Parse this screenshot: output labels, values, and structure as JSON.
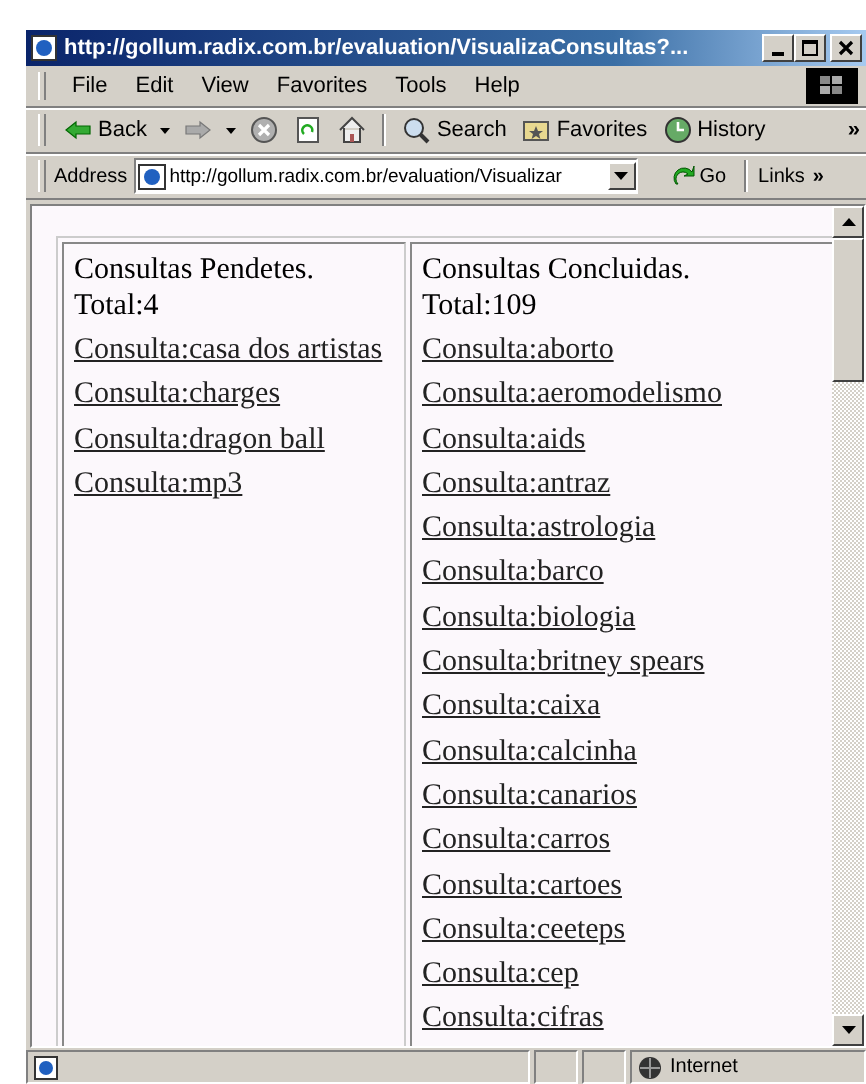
{
  "window": {
    "title": "http://gollum.radix.com.br/evaluation/VisualizaConsultas?..."
  },
  "menu": [
    "File",
    "Edit",
    "View",
    "Favorites",
    "Tools",
    "Help"
  ],
  "toolbar": {
    "buttons": [
      {
        "kind": "back",
        "label": "Back",
        "dropdown": true
      },
      {
        "kind": "forward",
        "dropdown": true
      },
      {
        "kind": "stop"
      },
      {
        "kind": "refresh"
      },
      {
        "kind": "home"
      },
      {
        "kind": "search",
        "label": "Search"
      },
      {
        "kind": "favorites",
        "label": "Favorites"
      },
      {
        "kind": "history",
        "label": "History"
      }
    ],
    "overflow": "»"
  },
  "address": {
    "label": "Address",
    "value": "http://gollum.radix.com.br/evaluation/Visualizar",
    "go": "Go",
    "links": "Links",
    "links_overflow": "»"
  },
  "pending": {
    "heading": "Consultas Pendetes.",
    "total": "Total:4",
    "links": [
      "Consulta:casa dos artistas",
      "Consulta:charges",
      "Consulta:dragon ball",
      "Consulta:mp3"
    ]
  },
  "completed": {
    "heading": "Consultas Concluidas.",
    "total": "Total:109",
    "links": [
      "Consulta:aborto",
      "Consulta:aeromodelismo",
      "Consulta:aids",
      "Consulta:antraz",
      "Consulta:astrologia",
      "Consulta:barco",
      "Consulta:biologia",
      "Consulta:britney spears",
      "Consulta:caixa",
      "Consulta:calcinha",
      "Consulta:canarios",
      "Consulta:carros",
      "Consulta:cartoes",
      "Consulta:ceeteps",
      "Consulta:cep",
      "Consulta:cifras"
    ]
  },
  "status_bar": {
    "zone": "Internet"
  }
}
